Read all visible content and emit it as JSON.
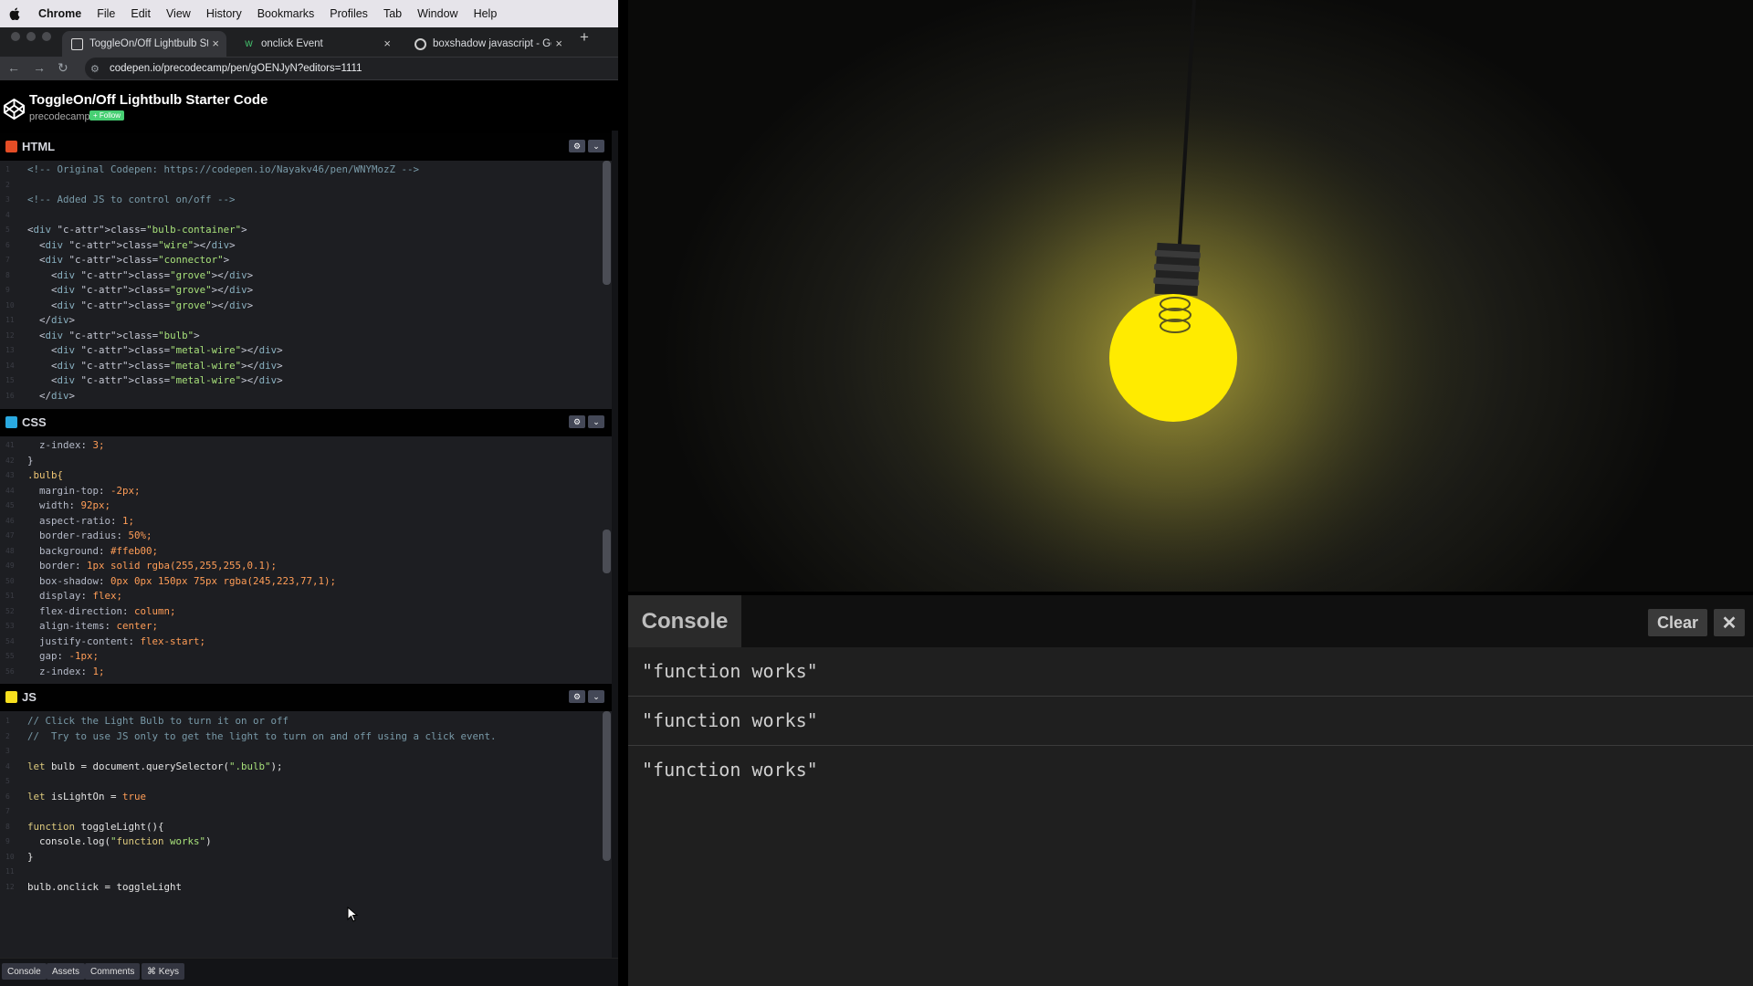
{
  "menubar": {
    "items": [
      "Chrome",
      "File",
      "Edit",
      "View",
      "History",
      "Bookmarks",
      "Profiles",
      "Tab",
      "Window",
      "Help"
    ]
  },
  "tabs": [
    {
      "title": "ToggleOn/Off Lightbulb Starter",
      "active": true
    },
    {
      "title": "onclick Event",
      "active": false
    },
    {
      "title": "boxshadow javascript - Goog",
      "active": false
    }
  ],
  "address": {
    "url": "codepen.io/precodecamp/pen/gOENJyN?editors=1111"
  },
  "pen": {
    "title": "ToggleOn/Off Lightbulb Starter Code",
    "author": "precodecamp",
    "follow_label": "+ Follow"
  },
  "editors": {
    "html_label": "HTML",
    "css_label": "CSS",
    "js_label": "JS"
  },
  "html_code": [
    "<!-- Original Codepen: https://codepen.io/Nayakv46/pen/WNYMozZ -->",
    "",
    "<!-- Added JS to control on/off -->",
    "",
    "<div class=\"bulb-container\">",
    "  <div class=\"wire\"></div>",
    "  <div class=\"connector\">",
    "    <div class=\"grove\"></div>",
    "    <div class=\"grove\"></div>",
    "    <div class=\"grove\"></div>",
    "  </div>",
    "  <div class=\"bulb\">",
    "    <div class=\"metal-wire\"></div>",
    "    <div class=\"metal-wire\"></div>",
    "    <div class=\"metal-wire\"></div>",
    "  </div>"
  ],
  "css_code": [
    "  z-index: 3;",
    "}",
    ".bulb{",
    "  margin-top: -2px;",
    "  width: 92px;",
    "  aspect-ratio: 1;",
    "  border-radius: 50%;",
    "  background: #ffeb00;",
    "  border: 1px solid rgba(255,255,255,0.1);",
    "  box-shadow: 0px 0px 150px 75px rgba(245,223,77,1);",
    "  display: flex;",
    "  flex-direction: column;",
    "  align-items: center;",
    "  justify-content: flex-start;",
    "  gap: -1px;",
    "  z-index: 1;"
  ],
  "js_code": [
    "// Click the Light Bulb to turn it on or off",
    "//  Try to use JS only to get the light to turn on and off using a click event.",
    "",
    "let bulb = document.querySelector(\".bulb\");",
    "",
    "let isLightOn = true",
    "",
    "function toggleLight(){",
    "  console.log(\"function works\")",
    "}",
    "",
    "bulb.onclick = toggleLight"
  ],
  "bottombar": {
    "console": "Console",
    "assets": "Assets",
    "comments": "Comments",
    "keys": "⌘ Keys"
  },
  "console": {
    "title": "Console",
    "clear_label": "Clear",
    "close_label": "✕",
    "logs": [
      "\"function works\"",
      "\"function works\"",
      "\"function works\""
    ]
  },
  "colors": {
    "bulb": "#ffeb00",
    "follow": "#47cf73"
  }
}
